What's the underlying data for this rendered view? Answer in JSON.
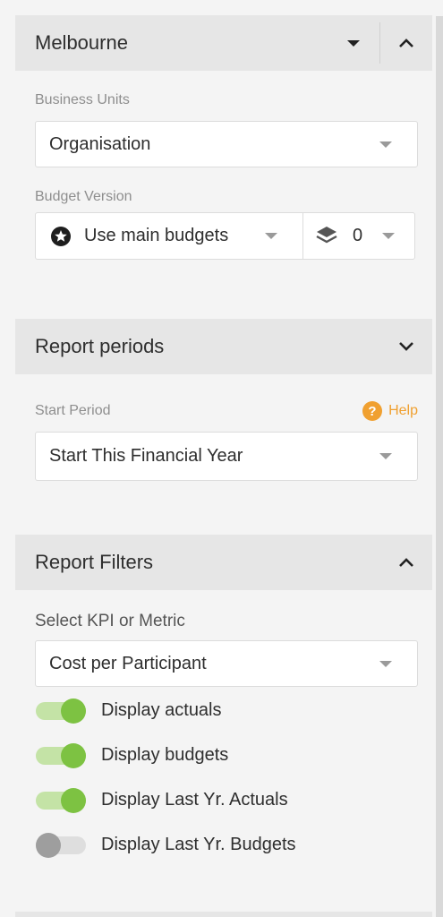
{
  "location": {
    "title": "Melbourne"
  },
  "business_units": {
    "label": "Business Units",
    "value": "Organisation"
  },
  "budget_version": {
    "label": "Budget Version",
    "value": "Use main budgets",
    "version_count": "0"
  },
  "report_periods": {
    "title": "Report periods",
    "start_label": "Start Period",
    "help": "Help",
    "start_value": "Start This Financial Year"
  },
  "report_filters": {
    "title": "Report Filters",
    "kpi_label": "Select KPI or Metric",
    "kpi_value": "Cost per Participant",
    "toggles": [
      {
        "label": "Display actuals",
        "on": true
      },
      {
        "label": "Display budgets",
        "on": true
      },
      {
        "label": "Display Last Yr. Actuals",
        "on": true
      },
      {
        "label": "Display Last Yr. Budgets",
        "on": false
      }
    ]
  },
  "colors": {
    "toggle_on": "#7dc242",
    "toggle_off": "#9e9e9e",
    "help": "#f0a030"
  }
}
